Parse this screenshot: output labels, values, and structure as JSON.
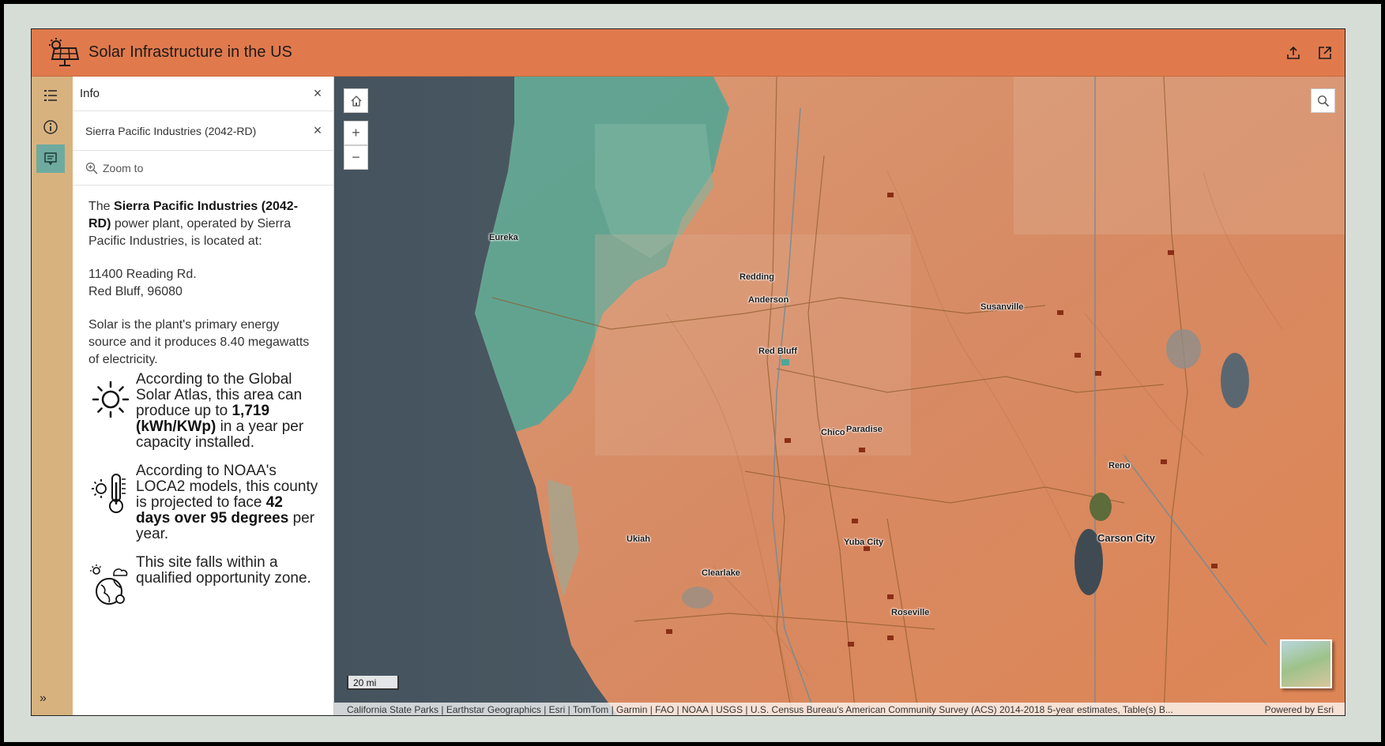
{
  "app": {
    "title": "Solar Infrastructure in the US",
    "accent": "#e07a4d",
    "rail_color": "#d8b27e",
    "active_color": "#6eaaa0"
  },
  "header": {
    "share_icon": "share-icon",
    "launch_icon": "launch-icon"
  },
  "rail": {
    "items": [
      {
        "icon": "legend-list-icon",
        "active": false
      },
      {
        "icon": "info-icon",
        "active": false
      },
      {
        "icon": "popup-icon",
        "active": true
      }
    ],
    "expand_label": "»"
  },
  "panel": {
    "title": "Info",
    "close_label": "×",
    "feature_title": "Sierra Pacific Industries (2042-RD)",
    "feature_close_label": "×",
    "zoom_label": "Zoom to",
    "intro": {
      "prefix": "The ",
      "plant_name": "Sierra Pacific Industries (2042-RD)",
      "suffix": " power plant, operated by Sierra Pacific Industries, is located at:"
    },
    "address_line1": "11400 Reading Rd.",
    "address_line2": "Red Bluff, 96080",
    "energy_text": "Solar is the plant's primary energy source and it produces 8.40 megawatts of electricity.",
    "solar": {
      "icon": "sun-icon",
      "prefix": "According to the Global Solar Atlas, this area can produce up to ",
      "value": "1,719 (kWh/KWp)",
      "suffix": " in a year per capacity installed."
    },
    "heat": {
      "icon": "thermometer-sun-icon",
      "prefix": "According to NOAA's LOCA2 models, this county is projected to face ",
      "value": "42 days over 95 degrees",
      "suffix": " per year."
    },
    "opportunity": {
      "icon": "globe-weather-icon",
      "text": "This site falls within a qualified opportunity zone."
    }
  },
  "map": {
    "home_icon": "home-icon",
    "zoom_in_label": "+",
    "zoom_out_label": "−",
    "search_icon": "search-icon",
    "scale_label": "20 mi",
    "attribution": "California State Parks | Earthstar Geographics | Esri | TomTom | Garmin | FAO | NOAA | USGS | U.S. Census Bureau's American Community Survey (ACS) 2014-2018 5-year estimates, Table(s) B...",
    "powered_by": "Powered by Esri",
    "cities": [
      {
        "name": "Eureka"
      },
      {
        "name": "Redding"
      },
      {
        "name": "Anderson"
      },
      {
        "name": "Red Bluff"
      },
      {
        "name": "Susanville"
      },
      {
        "name": "Chico"
      },
      {
        "name": "Paradise"
      },
      {
        "name": "Reno"
      },
      {
        "name": "Carson City"
      },
      {
        "name": "Ukiah"
      },
      {
        "name": "Yuba City"
      },
      {
        "name": "Clearlake"
      },
      {
        "name": "Roseville"
      }
    ]
  }
}
